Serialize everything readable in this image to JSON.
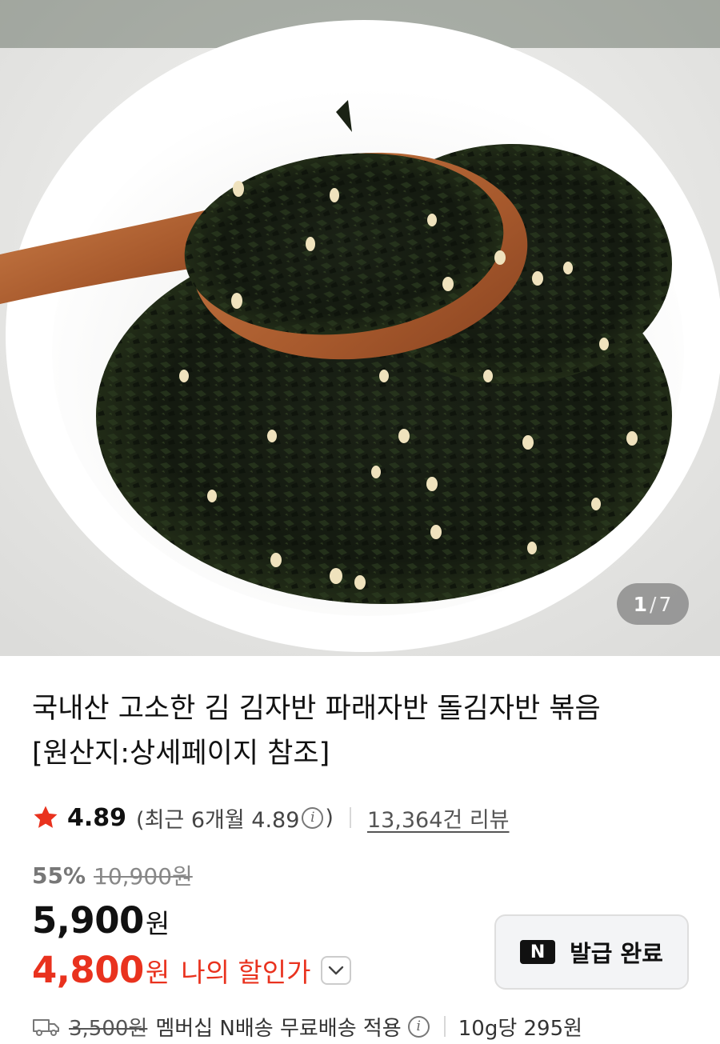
{
  "gallery": {
    "current_index": "1",
    "separator": "/",
    "total": "7"
  },
  "product": {
    "title_line1": "국내산 고소한 김 김자반 파래자반 돌김자반 볶음",
    "title_line2": "[원산지:상세페이지 참조]"
  },
  "rating": {
    "score": "4.89",
    "recent_label": "(최근 6개월 4.89",
    "recent_close": ")",
    "review_count_link": "13,364건 리뷰"
  },
  "pricing": {
    "discount_rate": "55%",
    "original_price": "10,900원",
    "sale_price": "5,900",
    "sale_unit": "원",
    "my_price": "4,800",
    "my_price_unit": "원",
    "my_price_label": "나의 할인가"
  },
  "coupon": {
    "badge": "N",
    "label": "발급 완료"
  },
  "shipping": {
    "original_fee": "3,500원",
    "text": "멤버십 N배송 무료배송 적용",
    "unit_price": "10g당 295원"
  },
  "colors": {
    "accent_red": "#e9321e",
    "star": "#e9321e"
  },
  "icons": [
    "star-icon",
    "info-icon",
    "chevron-down-icon",
    "truck-icon"
  ]
}
